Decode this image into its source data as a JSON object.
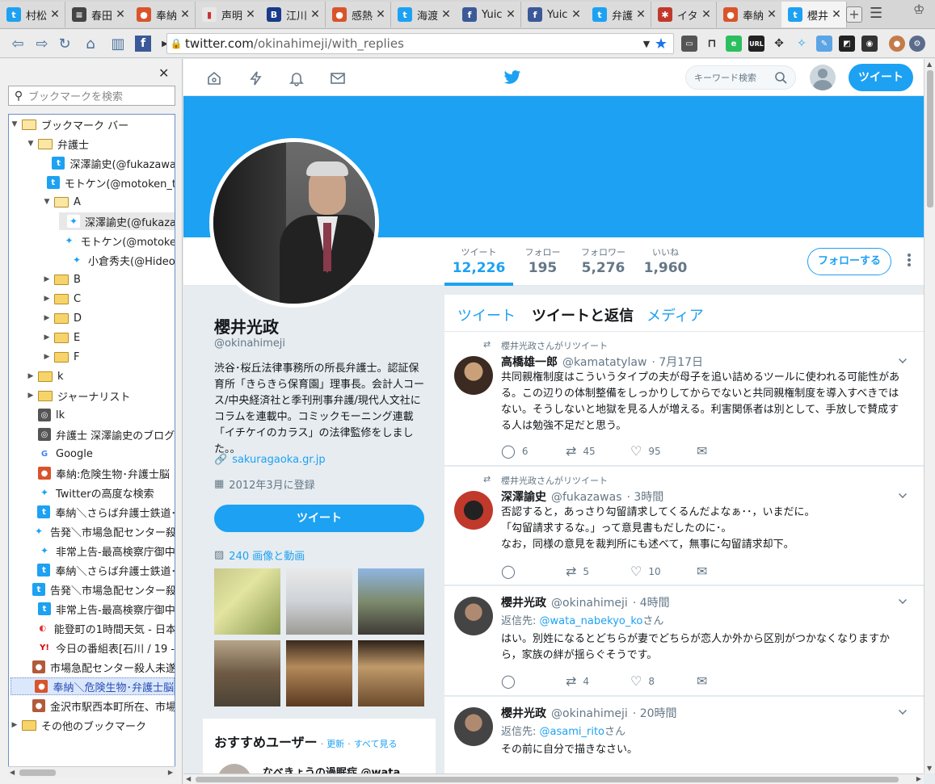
{
  "tabs": [
    {
      "label": "村松",
      "color": "#1da1f2",
      "glyph": "t"
    },
    {
      "label": "春田",
      "color": "#444444",
      "glyph": "≡"
    },
    {
      "label": "奉納",
      "color": "#d9542b",
      "glyph": "●"
    },
    {
      "label": "声明",
      "color": "#e7e7e7",
      "glyph": "▮"
    },
    {
      "label": "江川",
      "color": "#1a3a8a",
      "glyph": "B"
    },
    {
      "label": "感熱",
      "color": "#d9542b",
      "glyph": "●"
    },
    {
      "label": "海渡",
      "color": "#1da1f2",
      "glyph": "t"
    },
    {
      "label": "Yuic",
      "color": "#3b5998",
      "glyph": "f"
    },
    {
      "label": "Yuic",
      "color": "#3b5998",
      "glyph": "f"
    },
    {
      "label": "弁護",
      "color": "#1da1f2",
      "glyph": "t"
    },
    {
      "label": "イタ",
      "color": "#c0392b",
      "glyph": "✱"
    },
    {
      "label": "奉納",
      "color": "#d9542b",
      "glyph": "●"
    },
    {
      "label": "櫻井",
      "color": "#1da1f2",
      "glyph": "t"
    }
  ],
  "url": {
    "host": "twitter.com",
    "path": "/okinahimeji/with_replies"
  },
  "sidebar": {
    "search_placeholder": "ブックマークを検索",
    "items": [
      {
        "label": "ブックマーク バー",
        "type": "folder",
        "open": true,
        "depth": 0
      },
      {
        "label": "弁護士",
        "type": "folder",
        "open": true,
        "depth": 1
      },
      {
        "label": "深澤諭史(@fukazawa",
        "type": "tw-old",
        "depth": 2
      },
      {
        "label": "モトケン(@motoken_t",
        "type": "tw-old",
        "depth": 2
      },
      {
        "label": "A",
        "type": "folder",
        "open": true,
        "depth": 2
      },
      {
        "label": "深澤諭史(@fukaza",
        "type": "tw",
        "depth": 3,
        "selected": true
      },
      {
        "label": "モトケン(@motoke",
        "type": "tw",
        "depth": 3
      },
      {
        "label": "小倉秀夫(@Hideo",
        "type": "tw",
        "depth": 3
      },
      {
        "label": "B",
        "type": "folder",
        "open": false,
        "depth": 2
      },
      {
        "label": "C",
        "type": "folder",
        "open": false,
        "depth": 2
      },
      {
        "label": "D",
        "type": "folder",
        "open": false,
        "depth": 2
      },
      {
        "label": "E",
        "type": "folder",
        "open": false,
        "depth": 2
      },
      {
        "label": "F",
        "type": "folder",
        "open": false,
        "depth": 2
      },
      {
        "label": "k",
        "type": "folder",
        "open": false,
        "depth": 1
      },
      {
        "label": "ジャーナリスト",
        "type": "folder",
        "open": false,
        "depth": 1
      },
      {
        "label": "lk",
        "type": "globe",
        "depth": 1
      },
      {
        "label": "弁護士 深澤諭史のブログ",
        "type": "globe",
        "depth": 1
      },
      {
        "label": "Google",
        "type": "google",
        "depth": 1
      },
      {
        "label": "奉納:危険生物･弁護士脳",
        "type": "orange",
        "depth": 1
      },
      {
        "label": "Twitterの高度な検索",
        "type": "tw",
        "depth": 1
      },
      {
        "label": "奉納＼さらば弁護士鉄道･",
        "type": "tw-old",
        "depth": 1
      },
      {
        "label": "告発＼市場急配センター殺",
        "type": "tw",
        "depth": 1
      },
      {
        "label": "非常上告-最高検察庁御中",
        "type": "tw",
        "depth": 1
      },
      {
        "label": "奉納＼さらば弁護士鉄道･",
        "type": "tw-old",
        "depth": 1
      },
      {
        "label": "告発＼市場急配センター殺",
        "type": "tw-old",
        "depth": 1
      },
      {
        "label": "非常上告-最高検察庁御中",
        "type": "tw-old",
        "depth": 1
      },
      {
        "label": "能登町の1時間天気 - 日本",
        "type": "weather",
        "depth": 1
      },
      {
        "label": "今日の番組表[石川 / 19 -",
        "type": "yahoo",
        "depth": 1
      },
      {
        "label": "市場急配センター殺人未遂",
        "type": "orange2",
        "depth": 1
      },
      {
        "label": "奉納＼危険生物･弁護士脳",
        "type": "orange",
        "depth": 1,
        "highlight": true
      },
      {
        "label": "金沢市駅西本町所在、市場",
        "type": "orange2",
        "depth": 1
      },
      {
        "label": "その他のブックマーク",
        "type": "folder",
        "open": false,
        "depth": 0
      }
    ]
  },
  "header": {
    "search_placeholder": "キーワード検索",
    "tweet_button": "ツイート"
  },
  "stats": [
    {
      "label": "ツイート",
      "value": "12,226",
      "active": true
    },
    {
      "label": "フォロー",
      "value": "195"
    },
    {
      "label": "フォロワー",
      "value": "5,276"
    },
    {
      "label": "いいね",
      "value": "1,960"
    }
  ],
  "follow_button": "フォローする",
  "profile": {
    "name": "櫻井光政",
    "handle": "@okinahimeji",
    "bio": "渋谷･桜丘法律事務所の所長弁護士。認証保育所「きらきら保育園」理事長。会計人コース/中央経済社と季刊刑事弁護/現代人文社にコラムを連載中。コミックモーニング連載「イチケイのカラス」の法律監修をしました。。",
    "link": "sakuragaoka.gr.jp",
    "joined": "2012年3月に登録",
    "tweet_button": "ツイート",
    "media_count": "240 画像と動画"
  },
  "recommend": {
    "title": "おすすめユーザー",
    "refresh": "更新",
    "see_all": "すべて見る",
    "first_user": "なべきょうの過眠症 @wata"
  },
  "feed_tabs": [
    "ツイート",
    "ツイートと返信",
    "メディア"
  ],
  "tweets": [
    {
      "retweet_label": "櫻井光政さんがリツイート",
      "name": "高橋雄一郎",
      "handle": "@kamatatylaw",
      "time": "· 7月17日",
      "reply_to": "",
      "reply_user": "",
      "text": "共同親権制度はこういうタイプの夫が母子を追い詰めるツールに使われる可能性がある。この辺りの体制整備をしっかりしてからでないと共同親権制度を導入すべきではない。そうしないと地獄を見る人が増える。利害関係者は別として、手放しで賛成する人は勉強不足だと思う。",
      "replies": "6",
      "retweets": "45",
      "likes": "95"
    },
    {
      "retweet_label": "櫻井光政さんがリツイート",
      "name": "深澤諭史",
      "handle": "@fukazawas",
      "time": "· 3時間",
      "reply_to": "",
      "reply_user": "",
      "text": "否認すると，あっさり勾留請求してくるんだよなぁ･･，いまだに。\n「勾留請求するな。」って意見書もだしたのに･。\nなお，同様の意見を裁判所にも述べて，無事に勾留請求却下。",
      "replies": "",
      "retweets": "5",
      "likes": "10"
    },
    {
      "retweet_label": "",
      "name": "櫻井光政",
      "handle": "@okinahimeji",
      "time": "· 4時間",
      "reply_to": "返信先: ",
      "reply_user": "@wata_nabekyo_ko",
      "reply_suffix": "さん",
      "text": "はい。別姓になるとどちらが妻でどちらが恋人か外から区別がつかなくなりますから，家族の絆が揺らぐそうです。",
      "replies": "",
      "retweets": "4",
      "likes": "8"
    },
    {
      "retweet_label": "",
      "name": "櫻井光政",
      "handle": "@okinahimeji",
      "time": "· 20時間",
      "reply_to": "返信先: ",
      "reply_user": "@asami_rito",
      "reply_suffix": "さん",
      "text": "その前に自分で描きなさい。",
      "replies": "",
      "retweets": "",
      "likes": ""
    }
  ]
}
